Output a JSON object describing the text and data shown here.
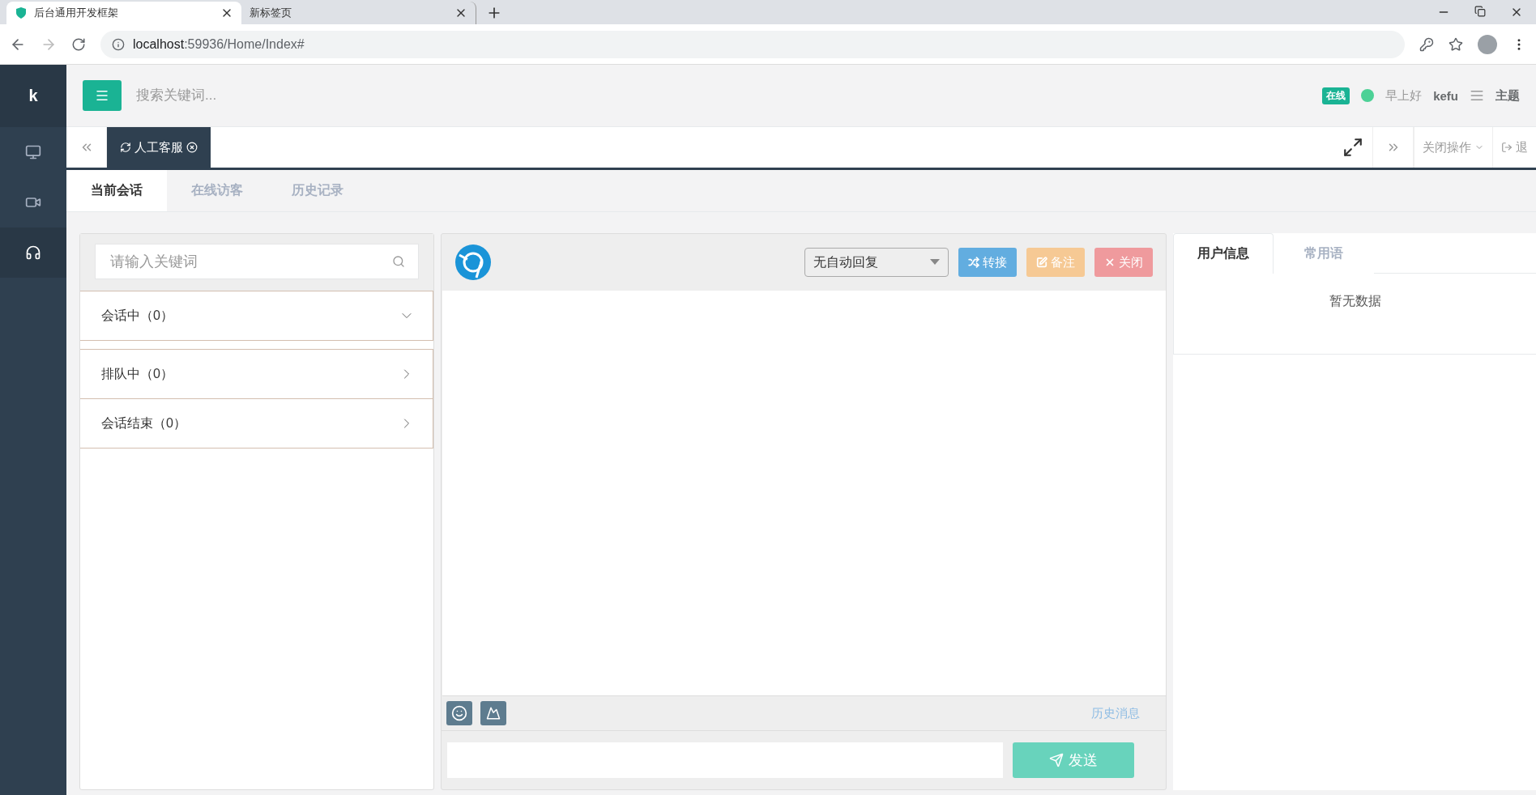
{
  "browser": {
    "tabs": [
      {
        "title": "后台通用开发框架",
        "selected": true
      },
      {
        "title": "新标签页",
        "selected": false
      }
    ],
    "address": {
      "host": "localhost",
      "path": ":59936/Home/Index#"
    }
  },
  "sidebar": {
    "logo": "k",
    "items": [
      {
        "kind": "monitor",
        "selected": false
      },
      {
        "kind": "camera",
        "selected": false
      },
      {
        "kind": "headset",
        "selected": true
      }
    ]
  },
  "header": {
    "search": {
      "placeholder": "搜索关键词..."
    },
    "status": "在线",
    "online": true,
    "greeting": "早上好",
    "user": "kefu",
    "theme": "主题"
  },
  "page_tabs": {
    "tabs": [
      {
        "label": "人工客服",
        "selected": true
      }
    ],
    "close_menu": "关闭操作",
    "logout": "退"
  },
  "content_tabs": [
    {
      "label": "当前会话",
      "selected": true
    },
    {
      "label": "在线访客",
      "selected": false
    },
    {
      "label": "历史记录",
      "selected": false
    }
  ],
  "sessions": {
    "search": {
      "placeholder": "请输入关键词"
    },
    "groups": [
      {
        "label": "会话中（0）",
        "expanded": true
      },
      {
        "label": "排队中（0）",
        "expanded": false
      },
      {
        "label": "会话结束（0）",
        "expanded": false
      }
    ]
  },
  "chat": {
    "auto_reply": "无自动回复",
    "buttons": [
      {
        "kind": "transfer",
        "label": "转接"
      },
      {
        "kind": "note",
        "label": "备注"
      },
      {
        "kind": "close",
        "label": "关闭"
      }
    ],
    "history_link": "历史消息",
    "send": "发送"
  },
  "info": {
    "tabs": [
      {
        "label": "用户信息",
        "selected": true
      },
      {
        "label": "常用语",
        "selected": false
      }
    ],
    "empty": "暂无数据"
  }
}
